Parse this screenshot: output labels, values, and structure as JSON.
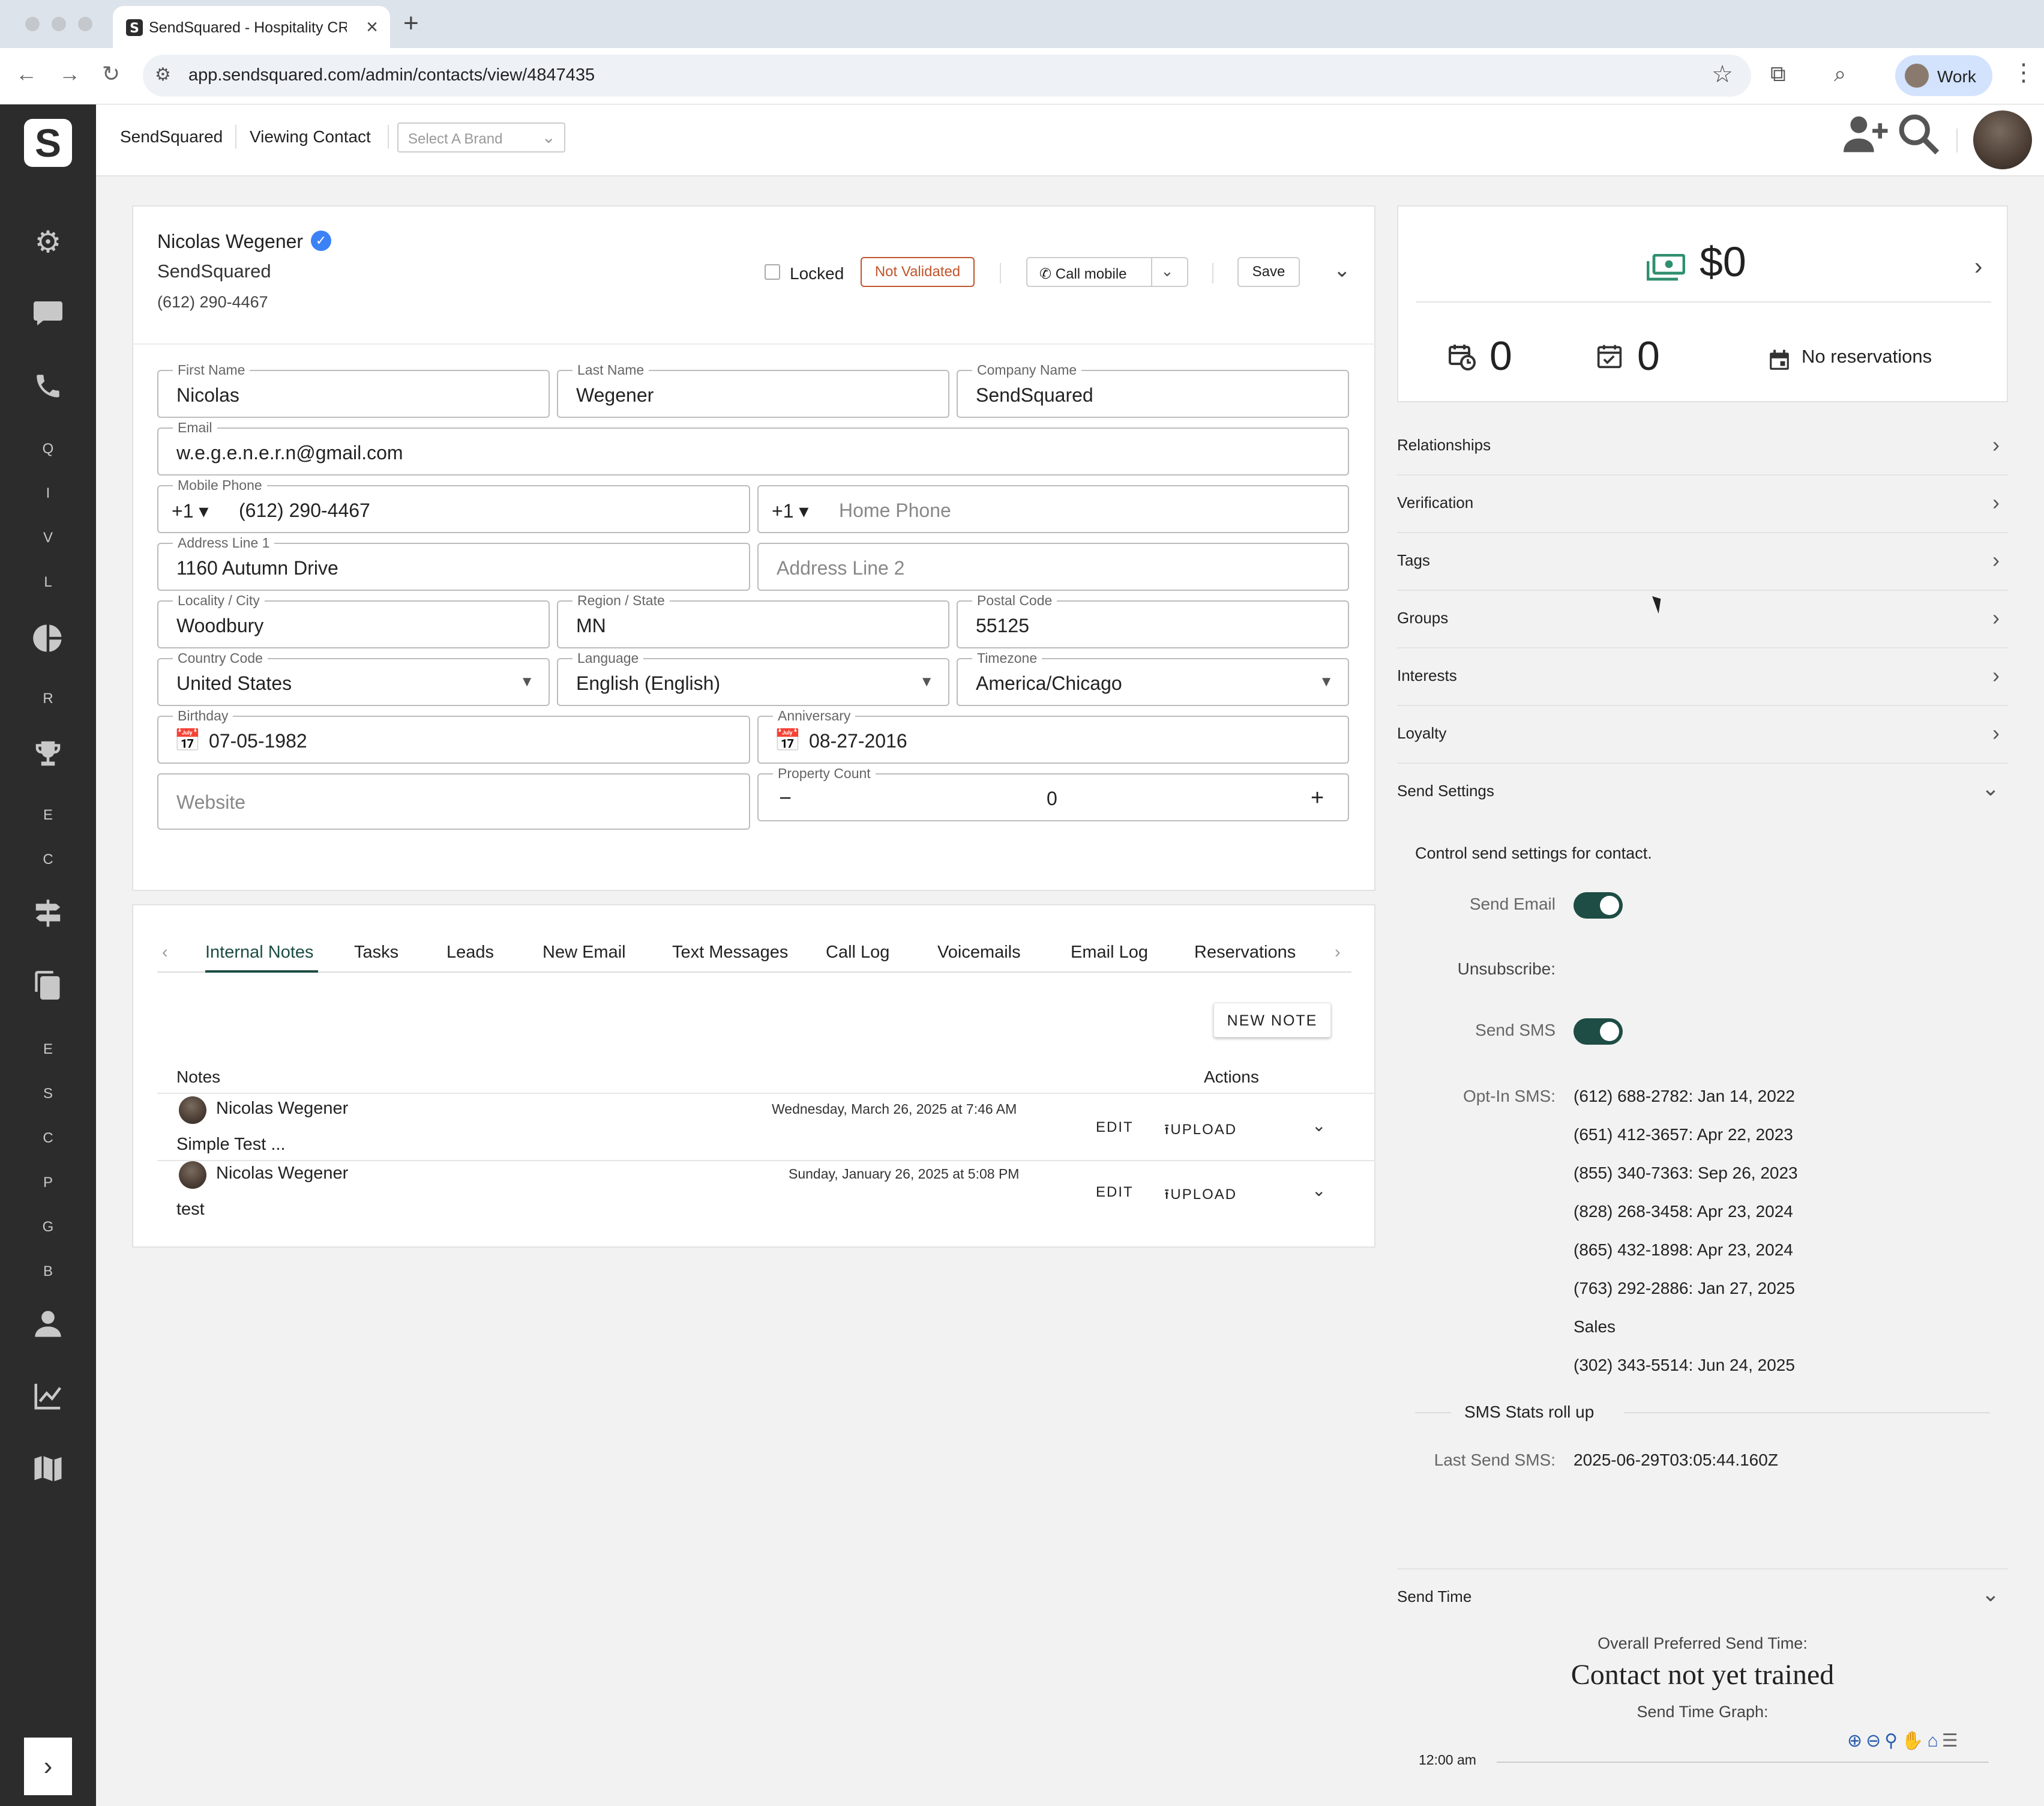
{
  "browser": {
    "tab_title": "SendSquared - Hospitality CR",
    "new_tab": "+",
    "url": "app.sendsquared.com/admin/contacts/view/4847435",
    "profile_label": "Work"
  },
  "sidebar": {
    "letters": [
      "Q",
      "I",
      "V",
      "L",
      "R",
      "E",
      "C",
      "E",
      "S",
      "C",
      "P",
      "G",
      "B"
    ],
    "expand": "›"
  },
  "header": {
    "brand": "SendSquared",
    "page": "Viewing Contact",
    "brand_select_placeholder": "Select A Brand"
  },
  "contact": {
    "name": "Nicolas Wegener",
    "company": "SendSquared",
    "phone": "(612) 290-4467",
    "locked_label": "Locked",
    "validation_badge": "Not Validated",
    "call_button": "Call mobile",
    "save_button": "Save"
  },
  "form": {
    "first_name": {
      "label": "First Name",
      "value": "Nicolas"
    },
    "last_name": {
      "label": "Last Name",
      "value": "Wegener"
    },
    "company_name": {
      "label": "Company Name",
      "value": "SendSquared"
    },
    "email": {
      "label": "Email",
      "value": "w.e.g.e.n.e.r.n@gmail.com"
    },
    "mobile_phone": {
      "label": "Mobile Phone",
      "country_code": "+1",
      "value": "(612) 290-4467"
    },
    "home_phone": {
      "country_code": "+1",
      "placeholder": "Home Phone"
    },
    "address1": {
      "label": "Address Line 1",
      "value": "1160 Autumn Drive"
    },
    "address2": {
      "placeholder": "Address Line 2"
    },
    "city": {
      "label": "Locality / City",
      "value": "Woodbury"
    },
    "region": {
      "label": "Region / State",
      "value": "MN"
    },
    "postal": {
      "label": "Postal Code",
      "value": "55125"
    },
    "country": {
      "label": "Country Code",
      "value": "United States"
    },
    "language": {
      "label": "Language",
      "value": "English (English)"
    },
    "timezone": {
      "label": "Timezone",
      "value": "America/Chicago"
    },
    "birthday": {
      "label": "Birthday",
      "value": "07-05-1982"
    },
    "anniversary": {
      "label": "Anniversary",
      "value": "08-27-2016"
    },
    "website": {
      "placeholder": "Website"
    },
    "property_count": {
      "label": "Property Count",
      "value": "0",
      "minus": "−",
      "plus": "+"
    }
  },
  "notes_panel": {
    "tabs": [
      "Internal Notes",
      "Tasks",
      "Leads",
      "New Email",
      "Text Messages",
      "Call Log",
      "Voicemails",
      "Email Log",
      "Reservations"
    ],
    "active_tab": "Internal Notes",
    "new_note_button": "NEW NOTE",
    "col_notes": "Notes",
    "col_actions": "Actions",
    "edit_label": "EDIT",
    "upload_label": "UPLOAD",
    "notes": [
      {
        "author": "Nicolas Wegener",
        "date": "Wednesday, March 26, 2025 at 7:46 AM",
        "body": "Simple Test ..."
      },
      {
        "author": "Nicolas Wegener",
        "date": "Sunday, January 26, 2025 at 5:08 PM",
        "body": "test"
      }
    ]
  },
  "stats": {
    "revenue": "$0",
    "count_a": "0",
    "count_b": "0",
    "reservations": "No reservations",
    "accent_color": "#2f8f6e"
  },
  "sections": [
    "Relationships",
    "Verification",
    "Tags",
    "Groups",
    "Interests",
    "Loyalty",
    "Send Settings"
  ],
  "send_settings": {
    "description": "Control send settings for contact.",
    "send_email_label": "Send Email",
    "send_email_on": true,
    "unsubscribe_label": "Unsubscribe:",
    "send_sms_label": "Send SMS",
    "send_sms_on": true,
    "optin_label": "Opt-In SMS:",
    "optins": [
      "(612) 688-2782: Jan 14, 2022",
      "(651) 412-3657: Apr 22, 2023",
      "(855) 340-7363: Sep 26, 2023",
      "(828) 268-3458: Apr 23, 2024",
      "(865) 432-1898: Apr 23, 2024",
      "(763) 292-2886: Jan 27, 2025",
      "Sales",
      "(302) 343-5514: Jun 24, 2025"
    ],
    "rollup_title": "SMS Stats roll up",
    "last_send_label": "Last Send SMS:",
    "last_send_value": "2025-06-29T03:05:44.160Z",
    "toggle_color": "#1d4d44"
  },
  "send_time": {
    "title": "Send Time",
    "preferred_label": "Overall Preferred Send Time:",
    "preferred_value": "Contact not yet trained",
    "graph_label": "Send Time Graph:",
    "first_tick": "12:00 am"
  }
}
